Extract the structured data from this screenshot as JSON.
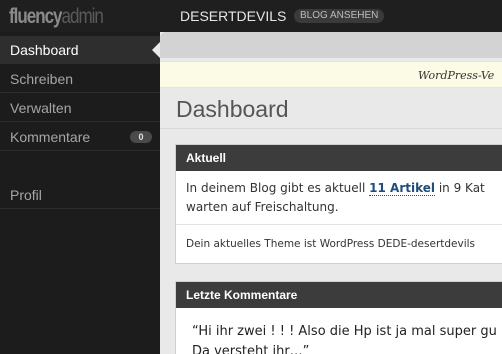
{
  "header": {
    "logo_main": "fluency",
    "logo_accent": "admin",
    "blog_name": "DESERTDEVILS",
    "view_blog": "BLOG ANSEHEN"
  },
  "sidebar": {
    "items": [
      {
        "label": "Dashboard"
      },
      {
        "label": "Schreiben"
      },
      {
        "label": "Verwalten"
      },
      {
        "label": "Kommentare",
        "badge": "0"
      },
      {
        "label": "Profil"
      }
    ]
  },
  "main": {
    "notice": "WordPress-Ve",
    "title": "Dashboard",
    "aktuell": {
      "title": "Aktuell",
      "line1_prefix": "In deinem Blog gibt es aktuell",
      "articles_link": "11 Artikel",
      "line1_suffix": "in 9 Kat",
      "line2": "warten auf Freischaltung.",
      "theme_line": "Dein aktuelles Theme ist WordPress DEDE-desertdevils"
    },
    "comments": {
      "title": "Letzte Kommentare",
      "quote_line1": "“Hi ihr zwei ! ! ! Also die Hp ist ja mal super gu",
      "quote_line2": "Da versteht ihr…”"
    }
  }
}
